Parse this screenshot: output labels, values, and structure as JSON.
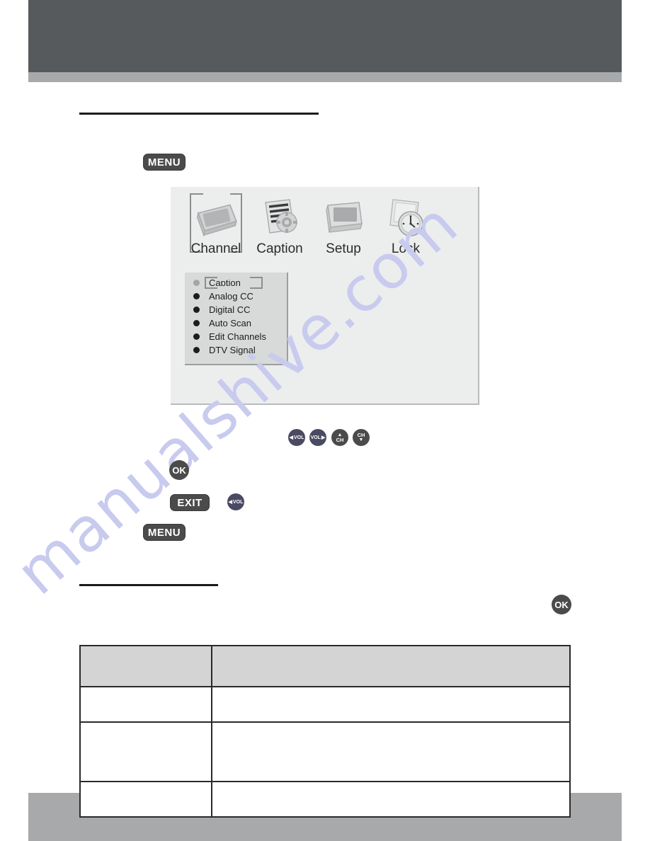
{
  "page": {
    "watermark_text": "manualshive.com",
    "header_color": "#565a5d",
    "band_color": "#a8a9ab"
  },
  "osd": {
    "panel_bg": "#eceded",
    "icons": [
      {
        "label": "Channel",
        "icon": "tv-screen-icon",
        "selected": true
      },
      {
        "label": "Caption",
        "icon": "document-gear-icon",
        "selected": false
      },
      {
        "label": "Setup",
        "icon": "tv-setup-icon",
        "selected": false
      },
      {
        "label": "Lock",
        "icon": "clock-lock-icon",
        "selected": false
      }
    ],
    "menu_items": [
      {
        "label": "Caption",
        "bullet": "dim",
        "selected": true
      },
      {
        "label": "Analog CC",
        "bullet": "solid",
        "selected": false
      },
      {
        "label": "Digital CC",
        "bullet": "solid",
        "selected": false
      },
      {
        "label": "Auto Scan",
        "bullet": "solid",
        "selected": false
      },
      {
        "label": "Edit Channels",
        "bullet": "solid",
        "selected": false
      },
      {
        "label": "DTV Signal",
        "bullet": "solid",
        "selected": false
      }
    ]
  },
  "keys": {
    "menu_top": "MENU",
    "menu_bottom": "MENU",
    "exit": "EXIT",
    "ok_step": "OK",
    "ok_section": "OK",
    "vol_left_label": "VOL",
    "vol_right_label": "VOL",
    "vol_exit_label": "VOL",
    "ch_label": "CH",
    "arrow_left": "◀",
    "arrow_right": "▶",
    "arrow_up": "▲",
    "arrow_down": "▼"
  },
  "table": {
    "headers": [
      "",
      ""
    ],
    "rows": [
      [
        "",
        ""
      ],
      [
        "",
        ""
      ],
      [
        "",
        ""
      ]
    ]
  }
}
